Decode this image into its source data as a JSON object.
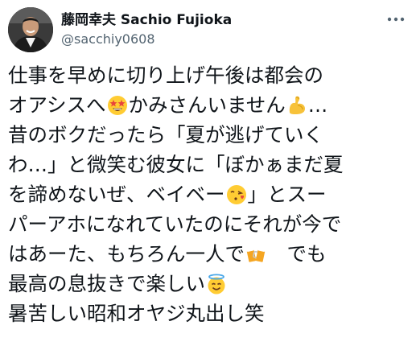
{
  "user": {
    "display_name": "藤岡幸夫 Sachio Fujioka",
    "handle": "@sacchiy0608"
  },
  "icons": {
    "avatar": "profile-photo",
    "more": "more-dots-icon"
  },
  "tweet": {
    "lines": [
      [
        "仕事を早めに切り上げ午後は都会の"
      ],
      [
        "オアシスへ",
        "かみさんいません",
        "…"
      ],
      [
        "昔のボクだったら「夏が逃げていく"
      ],
      [
        "わ…」と微笑む彼女に「ぼかぁまだ夏"
      ],
      [
        "を諦めないぜ、ベイベー",
        "」とスー"
      ],
      [
        "パーアホになれていたのにそれが今で"
      ],
      [
        "はあーた、もちろん一人で",
        "　でも"
      ],
      [
        "最高の息抜きで楽しい"
      ],
      [
        "暑苦しい昭和オヤジ丸出し笑"
      ]
    ],
    "emojis": [
      "star-struck-emoji",
      "flexed-biceps-emoji",
      "face-blowing-kiss-emoji",
      "clinking-beer-mugs-emoji",
      "smiling-face-with-halo-emoji"
    ]
  },
  "colors": {
    "text": "#0f1419",
    "secondary": "#536471"
  }
}
